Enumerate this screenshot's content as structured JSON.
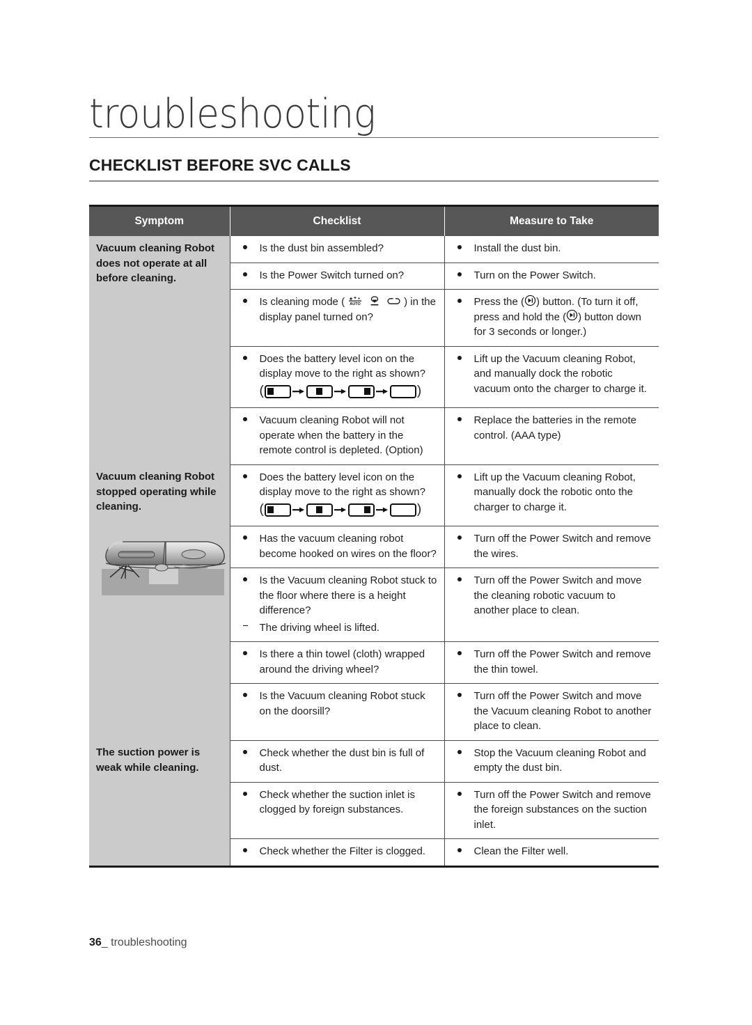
{
  "page": {
    "chapter_title": "troubleshooting",
    "section_heading": "CHECKLIST BEFORE SVC CALLS",
    "footer_page_number": "36",
    "footer_separator": "_",
    "footer_label": "troubleshooting",
    "colors": {
      "header_bg": "#575757",
      "header_text": "#ffffff",
      "symptom_bg": "#cbcbcb",
      "rule": "#4a4a4a",
      "text": "#231f20"
    }
  },
  "table": {
    "columns": [
      "Symptom",
      "Checklist",
      "Measure to Take"
    ],
    "groups": [
      {
        "symptom": "Vacuum cleaning Robot does not operate at all before cleaning.",
        "has_image": false,
        "rows": [
          {
            "checklist": [
              {
                "marker": "dot",
                "text": "Is the dust bin assembled?"
              }
            ],
            "measure": [
              {
                "marker": "dot",
                "text": "Install the dust bin."
              }
            ]
          },
          {
            "checklist": [
              {
                "marker": "dot",
                "text": "Is the Power Switch turned on?"
              }
            ],
            "measure": [
              {
                "marker": "dot",
                "text": "Turn on the Power Switch."
              }
            ]
          },
          {
            "checklist": [
              {
                "marker": "dot",
                "text_before": "Is cleaning mode (",
                "icons": [
                  "auto-mode-icon",
                  "spot-mode-icon",
                  "edge-mode-icon"
                ],
                "text_after": ") in the display panel turned on?"
              }
            ],
            "measure": [
              {
                "marker": "dot",
                "text_before": "Press the (",
                "icon": "play-pause-button-icon",
                "text_mid": ") button. (To turn it off, press and hold the (",
                "icon2": "play-pause-button-icon",
                "text_after": ") button down for 3 seconds or longer.)"
              }
            ]
          },
          {
            "checklist": [
              {
                "marker": "dot",
                "text": "Does the battery level icon on the display move to the right as shown?"
              }
            ],
            "battery_sequence": [
              "level-1",
              "level-2",
              "level-3",
              "level-empty"
            ],
            "measure": [
              {
                "marker": "dot",
                "text": "Lift up the Vacuum cleaning Robot, and manually dock the robotic vacuum onto the charger to charge it."
              }
            ]
          },
          {
            "checklist": [
              {
                "marker": "dot",
                "text": "Vacuum cleaning Robot will not operate when the battery in the remote control is depleted. (Option)"
              }
            ],
            "measure": [
              {
                "marker": "dot",
                "text": "Replace the batteries in the remote control. (AAA type)"
              }
            ]
          }
        ]
      },
      {
        "symptom": "Vacuum cleaning Robot stopped operating while cleaning.",
        "has_image": true,
        "image_name": "robot-vacuum-side-view-illustration",
        "rows": [
          {
            "checklist": [
              {
                "marker": "dot",
                "text": "Does the battery level icon on the display move to the right as shown?"
              }
            ],
            "battery_sequence": [
              "level-1",
              "level-2",
              "level-3",
              "level-empty"
            ],
            "measure": [
              {
                "marker": "dot",
                "text": "Lift up the Vacuum cleaning Robot, manually dock the robotic onto the charger to charge it."
              }
            ]
          },
          {
            "checklist": [
              {
                "marker": "dot",
                "text": "Has the vacuum cleaning robot become hooked on wires on the floor?"
              }
            ],
            "measure": [
              {
                "marker": "dot",
                "text": "Turn off the Power Switch and remove the wires."
              }
            ]
          },
          {
            "checklist": [
              {
                "marker": "dot",
                "text": "Is the Vacuum cleaning Robot stuck to the floor where there is a height difference?"
              },
              {
                "marker": "dash",
                "text": "The driving wheel is lifted."
              }
            ],
            "measure": [
              {
                "marker": "dot",
                "text": "Turn off the Power Switch and move the cleaning robotic vacuum to another place to clean."
              }
            ]
          },
          {
            "checklist": [
              {
                "marker": "dot",
                "text": "Is there a thin towel (cloth) wrapped around the driving wheel?"
              }
            ],
            "measure": [
              {
                "marker": "dot",
                "text": "Turn off the Power Switch and remove the thin towel."
              }
            ]
          },
          {
            "checklist": [
              {
                "marker": "dot",
                "text": "Is the Vacuum cleaning Robot stuck on the doorsill?"
              }
            ],
            "measure": [
              {
                "marker": "dot",
                "text": "Turn off the Power Switch and move the Vacuum cleaning Robot to another place to clean."
              }
            ]
          }
        ]
      },
      {
        "symptom": "The suction power is weak while cleaning.",
        "has_image": false,
        "rows": [
          {
            "checklist": [
              {
                "marker": "dot",
                "text": "Check whether the dust bin is full of dust."
              }
            ],
            "measure": [
              {
                "marker": "dot",
                "text": "Stop the Vacuum cleaning Robot and empty the dust bin."
              }
            ]
          },
          {
            "checklist": [
              {
                "marker": "dot",
                "text": "Check whether the suction inlet is clogged by foreign substances."
              }
            ],
            "measure": [
              {
                "marker": "dot",
                "text": "Turn off the Power Switch and remove the foreign substances on the suction inlet."
              }
            ]
          },
          {
            "checklist": [
              {
                "marker": "dot",
                "text": "Check whether the Filter is clogged."
              }
            ],
            "measure": [
              {
                "marker": "dot",
                "text": "Clean the Filter well."
              }
            ]
          }
        ]
      }
    ]
  }
}
